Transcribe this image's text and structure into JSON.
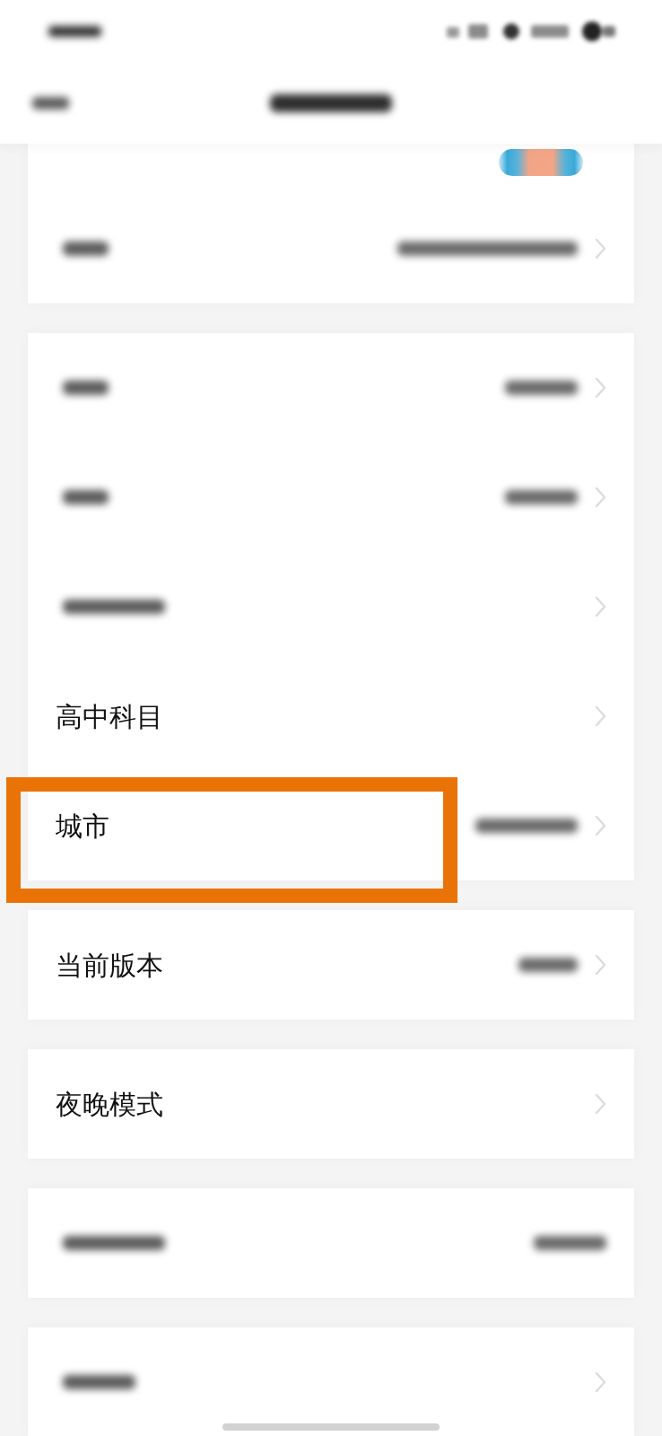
{
  "status_bar": {
    "time": {
      "kind": "blur-medium"
    },
    "icons_blurred": true
  },
  "nav": {
    "back": {
      "kind": "blur-short"
    },
    "title": {
      "kind": "blur-long"
    }
  },
  "cards": [
    {
      "rows": [
        {
          "kind": "avatar",
          "highlighted": false
        },
        {
          "kind": "setting",
          "label": {
            "kind": "blur-short"
          },
          "value": {
            "kind": "blur-xlong"
          },
          "chevron": true,
          "highlighted": false
        }
      ]
    },
    {
      "rows": [
        {
          "kind": "setting",
          "label": {
            "kind": "blur-short"
          },
          "value": {
            "kind": "blur-medium"
          },
          "chevron": true,
          "highlighted": false
        },
        {
          "kind": "setting",
          "label": {
            "kind": "blur-short"
          },
          "value": {
            "kind": "blur-medium"
          },
          "chevron": true,
          "highlighted": false
        },
        {
          "kind": "setting",
          "label": {
            "kind": "blur-long"
          },
          "chevron": true,
          "highlighted": false
        },
        {
          "kind": "setting",
          "label": "高中科目",
          "chevron": true,
          "highlighted": false
        },
        {
          "kind": "setting",
          "label": "城市",
          "value": {
            "kind": "blur-long"
          },
          "chevron": true,
          "highlighted": true
        }
      ]
    },
    {
      "rows": [
        {
          "kind": "setting",
          "label": "当前版本",
          "value": {
            "kind": "blur-numeric"
          },
          "chevron": true,
          "highlighted": false
        }
      ]
    },
    {
      "rows": [
        {
          "kind": "setting",
          "label": "夜晚模式",
          "chevron": true,
          "highlighted": false
        }
      ]
    },
    {
      "rows": [
        {
          "kind": "setting",
          "label": {
            "kind": "blur-long"
          },
          "value": {
            "kind": "blur-medium"
          },
          "chevron": false,
          "highlighted": false
        }
      ]
    },
    {
      "rows": [
        {
          "kind": "setting",
          "label": {
            "kind": "blur-medium"
          },
          "chevron": true,
          "highlighted": false
        }
      ]
    }
  ],
  "home_indicator": true
}
